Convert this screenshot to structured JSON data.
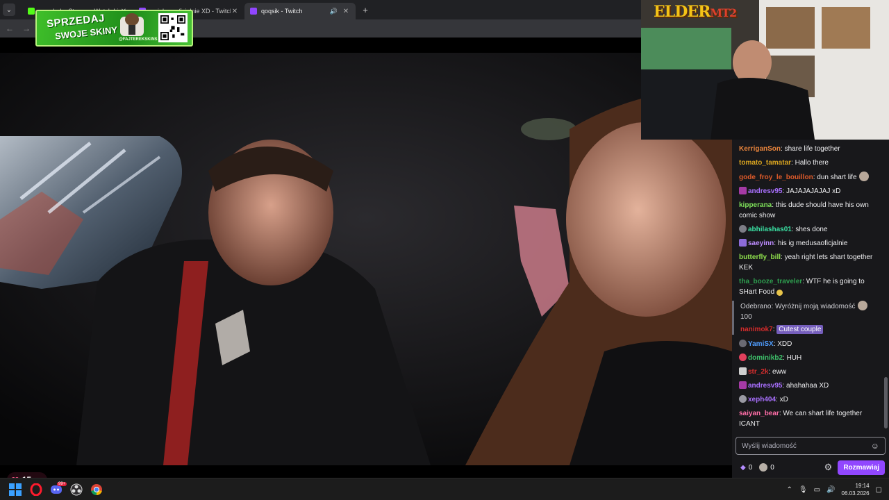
{
  "browser": {
    "tabs": [
      {
        "title": "mandarka Stream - Watch Live",
        "favicon_color": "#53fc18",
        "active": false
      },
      {
        "title": "swiekossoficjalnie XD - Twitch",
        "favicon_color": "#9146ff",
        "active": false
      },
      {
        "title": "qoqsik - Twitch",
        "favicon_color": "#9146ff",
        "active": true
      }
    ],
    "new_tab": "+",
    "back": "←",
    "forward": "→"
  },
  "sponsor": {
    "line1": "SPRZEDAJ",
    "line2": "SWOJE SKINY",
    "handle": "@FAJTEREKSKINS"
  },
  "video": {
    "hearts_count": "15"
  },
  "webcam": {
    "logo_main": "ELDER",
    "logo_suffix": "MT2"
  },
  "chat": {
    "messages": [
      {
        "user": "KerriganSon",
        "color": "#e8843c",
        "text": "share life together"
      },
      {
        "user": "tomato_tamatar",
        "color": "#daa520",
        "text": "Hallo there"
      },
      {
        "user": "gode_froy_le_bouillon",
        "color": "#e05b2a",
        "text": "dun shart life"
      },
      {
        "user": "andresv95",
        "color": "#a970ff",
        "text": "JAJAJAJAJAJ xD"
      },
      {
        "user": "kipperana",
        "color": "#7ee05a",
        "text": "this dude should have his own comic show"
      },
      {
        "user": "abhilashas01",
        "color": "#3ae0a3",
        "text": "shes done"
      },
      {
        "user": "saeyinn",
        "color": "#bd8cff",
        "text": "his ig medusaoficjalnie"
      },
      {
        "user": "butterfly_bill",
        "color": "#8fe04d",
        "text": "yeah right lets shart together KEK"
      },
      {
        "user": "tha_booze_traveler",
        "color": "#2e9e4f",
        "text": "WTF he is going to SHart Food"
      }
    ],
    "redeem": {
      "text": "Odebrano: Wyróżnij moją wiadomość",
      "cost": "100",
      "user": "nanimok7",
      "user_color": "#d42b2b",
      "message": "Cutest couple"
    },
    "messages2": [
      {
        "user": "YamiSX",
        "color": "#4f9dff",
        "text": "XDD"
      },
      {
        "user": "dominikb2",
        "color": "#3ec26b",
        "text": "HUH"
      },
      {
        "user": "str_2k",
        "color": "#d62d2d",
        "text": "eww"
      },
      {
        "user": "andresv95",
        "color": "#a970ff",
        "text": "ahahahaa XD"
      },
      {
        "user": "xeph404",
        "color": "#a970ff",
        "text": "xD"
      },
      {
        "user": "saiyan_bear",
        "color": "#ff6ea8",
        "text": "We can shart life together ICANT"
      }
    ],
    "input_placeholder": "Wyślij wiadomość",
    "points_a": "0",
    "points_b": "0",
    "chat_button": "Rozmawiaj"
  },
  "taskbar": {
    "time": "19:14",
    "date": "06.03.2026",
    "discord_badge": "99+"
  }
}
